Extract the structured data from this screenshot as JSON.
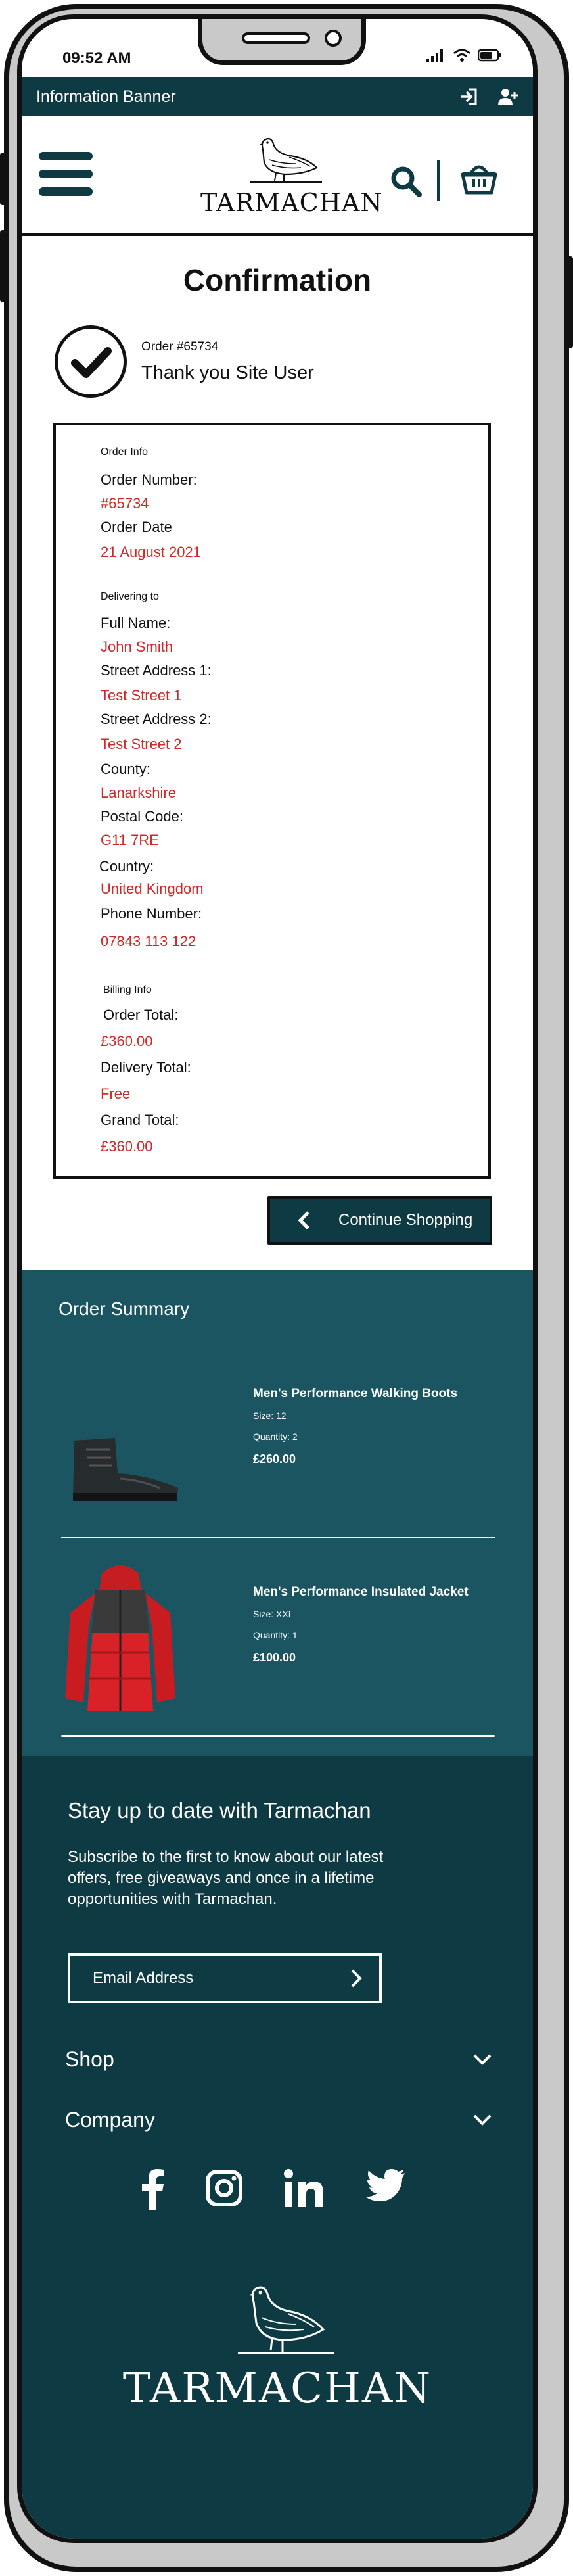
{
  "status": {
    "time": "09:52 AM"
  },
  "banner": {
    "title": "Information Banner",
    "icons": [
      "login-icon",
      "add-user-icon"
    ]
  },
  "header": {
    "logo_text": "TARMACHAN",
    "icons": [
      "menu-icon",
      "search-icon",
      "basket-icon"
    ]
  },
  "confirmation": {
    "title": "Confirmation",
    "order_ref": "Order #65734",
    "thanks": "Thank you Site User"
  },
  "order_info": {
    "section_order": "Order Info",
    "order_number_label": "Order Number:",
    "order_number": "#65734",
    "order_date_label": "Order Date",
    "order_date": "21 August 2021",
    "section_delivery": "Delivering to",
    "full_name_label": "Full Name:",
    "full_name": "John Smith",
    "street1_label": "Street Address 1:",
    "street1": "Test Street 1",
    "street2_label": "Street Address 2:",
    "street2": "Test Street 2",
    "county_label": "County:",
    "county": "Lanarkshire",
    "postal_label": "Postal Code:",
    "postal": "G11 7RE",
    "country_label": "Country:",
    "country": "United Kingdom",
    "phone_label": "Phone Number:",
    "phone": "07843 113 122",
    "section_billing": "Billing Info",
    "order_total_label": "Order Total:",
    "order_total": "£360.00",
    "delivery_total_label": "Delivery Total:",
    "delivery_total": "Free",
    "grand_total_label": "Grand Total:",
    "grand_total": "£360.00"
  },
  "continue_button": {
    "label": "Continue Shopping"
  },
  "summary": {
    "title": "Order Summary",
    "products": [
      {
        "name": "Men's Performance Walking Boots",
        "size": "Size: 12",
        "quantity": "Quantity: 2",
        "price": "£260.00"
      },
      {
        "name": "Men's Performance Insulated Jacket",
        "size": "Size: XXL",
        "quantity": "Quantity: 1",
        "price": "£100.00"
      }
    ]
  },
  "footer": {
    "heading": "Stay up to date with Tarmachan",
    "text": "Subscribe to the first to know about our latest offers, free giveaways and once in a lifetime opportunities with Tarmachan.",
    "email_placeholder": "Email Address",
    "shop_label": "Shop",
    "company_label": "Company",
    "socials": [
      "facebook-icon",
      "instagram-icon",
      "linkedin-icon",
      "twitter-icon"
    ],
    "logo_text": "TARMACHAN"
  },
  "colors": {
    "dark_teal": "#0e3a44",
    "summary_teal": "#1b5561",
    "accent_red": "#d0282a"
  }
}
